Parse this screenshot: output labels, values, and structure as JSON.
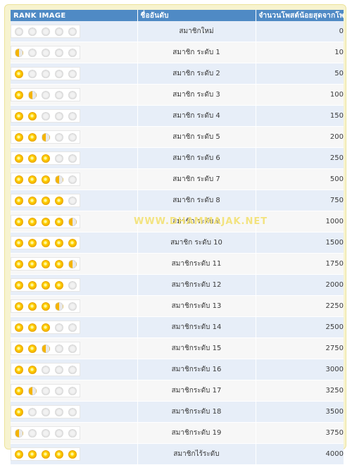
{
  "table": {
    "headers": [
      "RANK IMAGE",
      "ชื่ออันดับ",
      "จำนวนโพสต์น้อยสุดจากโพสต์"
    ],
    "rows": [
      {
        "stars": [
          0,
          0,
          0,
          0,
          0
        ],
        "name": "สมาชิกใหม่",
        "posts": "0"
      },
      {
        "stars": [
          1,
          0,
          0,
          0,
          0
        ],
        "name": "สมาชิก ระดับ 1",
        "posts": "10"
      },
      {
        "stars": [
          2,
          0,
          0,
          0,
          0
        ],
        "name": "สมาชิก ระดับ 2",
        "posts": "50"
      },
      {
        "stars": [
          2,
          1,
          0,
          0,
          0
        ],
        "name": "สมาชิก ระดับ 3",
        "posts": "100"
      },
      {
        "stars": [
          2,
          2,
          0,
          0,
          0
        ],
        "name": "สมาชิก ระดับ 4",
        "posts": "150"
      },
      {
        "stars": [
          2,
          2,
          1,
          0,
          0
        ],
        "name": "สมาชิก ระดับ 5",
        "posts": "200"
      },
      {
        "stars": [
          2,
          2,
          2,
          0,
          0
        ],
        "name": "สมาชิก ระดับ 6",
        "posts": "250"
      },
      {
        "stars": [
          2,
          2,
          2,
          1,
          0
        ],
        "name": "สมาชิก ระดับ 7",
        "posts": "500"
      },
      {
        "stars": [
          2,
          2,
          2,
          2,
          0
        ],
        "name": "สมาชิก ระดับ 8",
        "posts": "750"
      },
      {
        "stars": [
          2,
          2,
          2,
          2,
          1
        ],
        "name": "สมาชิก ระดับ 9",
        "posts": "1000"
      },
      {
        "stars": [
          2,
          2,
          2,
          2,
          2
        ],
        "name": "สมาชิก ระดับ 10",
        "posts": "1500"
      },
      {
        "stars": [
          2,
          2,
          2,
          2,
          1
        ],
        "name": "สมาชิกระดับ 11",
        "posts": "1750"
      },
      {
        "stars": [
          2,
          2,
          2,
          2,
          0
        ],
        "name": "สมาชิกระดับ 12",
        "posts": "2000"
      },
      {
        "stars": [
          2,
          2,
          2,
          1,
          0
        ],
        "name": "สมาชิกระดับ 13",
        "posts": "2250"
      },
      {
        "stars": [
          2,
          2,
          2,
          0,
          0
        ],
        "name": "สมาชิกระดับ 14",
        "posts": "2500"
      },
      {
        "stars": [
          2,
          2,
          1,
          0,
          0
        ],
        "name": "สมาชิกระดับ 15",
        "posts": "2750"
      },
      {
        "stars": [
          2,
          2,
          0,
          0,
          0
        ],
        "name": "สมาชิกระดับ 16",
        "posts": "3000"
      },
      {
        "stars": [
          2,
          1,
          0,
          0,
          0
        ],
        "name": "สมาชิกระดับ 17",
        "posts": "3250"
      },
      {
        "stars": [
          2,
          0,
          0,
          0,
          0
        ],
        "name": "สมาชิกระดับ 18",
        "posts": "3500"
      },
      {
        "stars": [
          1,
          0,
          0,
          0,
          0
        ],
        "name": "สมาชิกระดับ 19",
        "posts": "3750"
      },
      {
        "stars": [
          2,
          2,
          2,
          2,
          2
        ],
        "name": "สมาชิกไร้ระดับ",
        "posts": "4000"
      }
    ]
  },
  "watermark": "WWW.DHAMMAJAK.NET",
  "colors": {
    "header": "#4f8ac5",
    "row_odd": "#e7eef8",
    "row_even": "#f7f7f7",
    "frame": "#f7f3cf",
    "star": "#ffd400"
  },
  "icons": {
    "star_full": "gold-star-icon",
    "star_half": "half-star-icon",
    "star_empty": "empty-star-icon"
  }
}
